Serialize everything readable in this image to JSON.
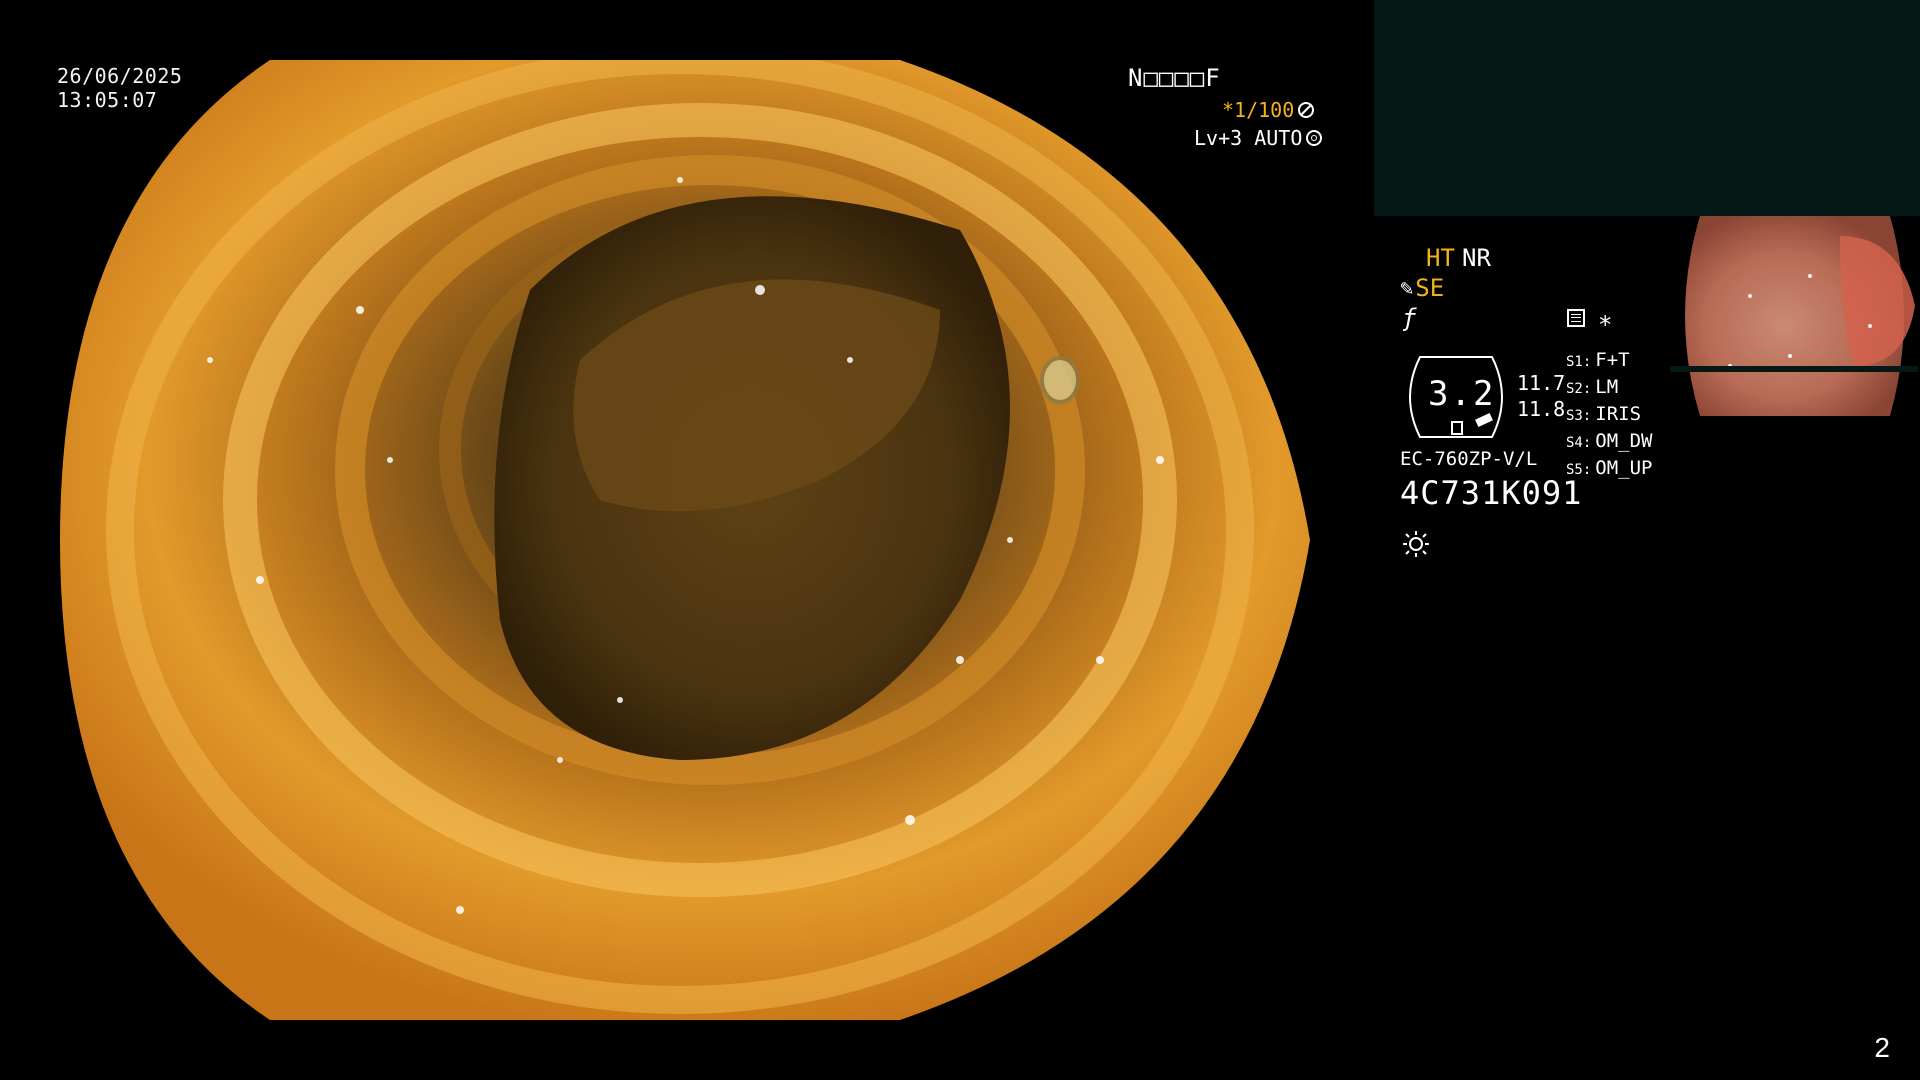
{
  "overlay": {
    "date": "26/06/2025",
    "time": "13:05:07",
    "patient_id": "N□□□□F",
    "shutter": "*1/100",
    "iris": "Lv+3 AUTO"
  },
  "settings": {
    "ht": "HT",
    "nr": "NR",
    "se": "SE",
    "gauge_value": "3.2",
    "gauge_top": "11.7",
    "gauge_bottom": "11.8",
    "switches": [
      {
        "key": "S1:",
        "value": "F+T"
      },
      {
        "key": "S2:",
        "value": "LM"
      },
      {
        "key": "S3:",
        "value": "IRIS"
      },
      {
        "key": "S4:",
        "value": "OM_DW"
      },
      {
        "key": "S5:",
        "value": "OM_UP"
      }
    ],
    "scope_model": "EC-760ZP-V/L",
    "scope_serial": "4C731K091"
  },
  "footer": {
    "page_number": "2"
  },
  "colors": {
    "accent_orange": "#f3b21d",
    "sub_panel": "#041915",
    "background": "#000000"
  },
  "icons": [
    "fan-icon",
    "iris-icon",
    "pen-icon",
    "function-icon",
    "grid-icon",
    "light-icon"
  ]
}
